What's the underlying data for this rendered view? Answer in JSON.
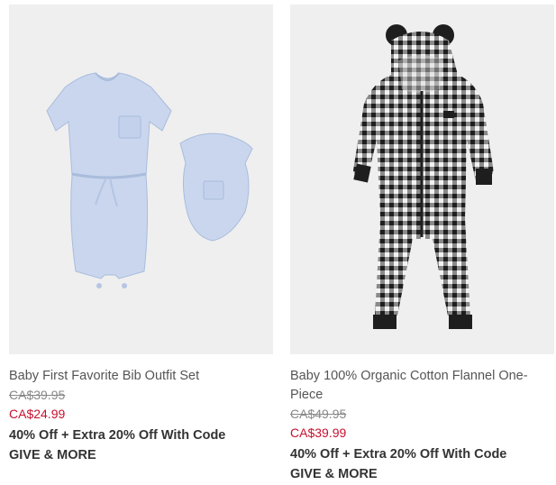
{
  "products": [
    {
      "name": "Baby First Favorite Bib Outfit Set",
      "original_price": "CA$39.95",
      "sale_price": "CA$24.99",
      "promo_line1": "40% Off + Extra 20% Off With Code",
      "promo_line2": "GIVE & MORE",
      "image_description_icon": "romper-with-bib-image"
    },
    {
      "name": "Baby 100% Organic Cotton Flannel One-Piece",
      "original_price": "CA$49.95",
      "sale_price": "CA$39.99",
      "promo_line1": "40% Off + Extra 20% Off With Code",
      "promo_line2": "GIVE & MORE",
      "image_description_icon": "gingham-onepiece-image"
    }
  ],
  "colors": {
    "sale_red": "#c8102e",
    "image_bg": "#efefef",
    "romper_blue": "#c9d6ee"
  }
}
